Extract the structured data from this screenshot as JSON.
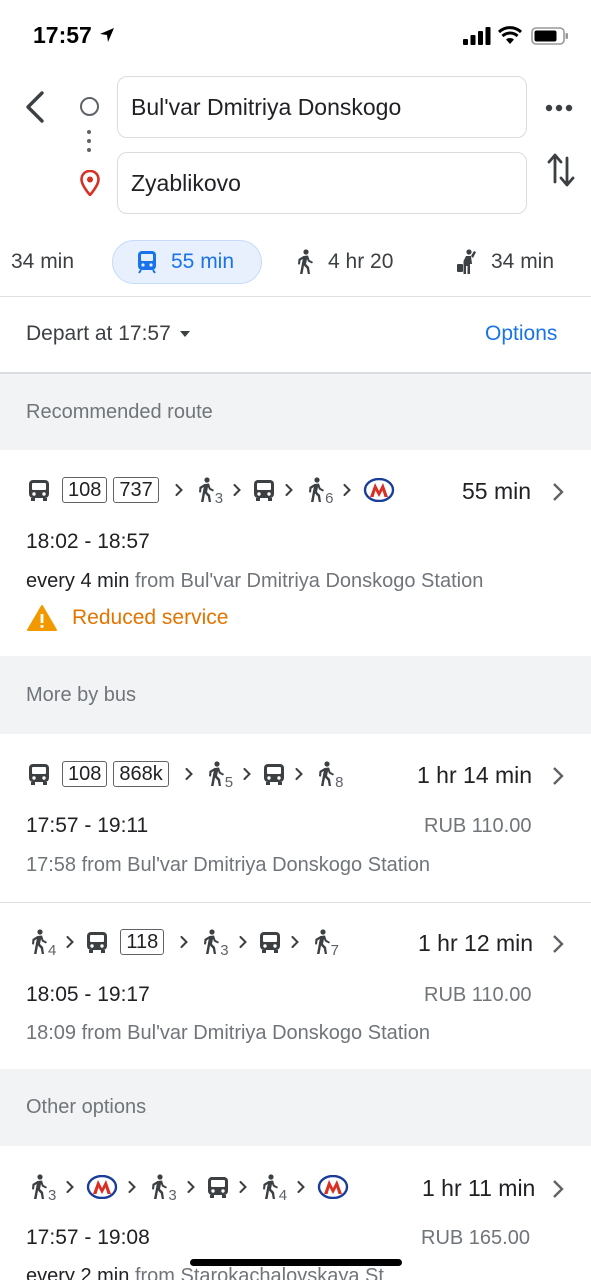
{
  "status_bar": {
    "time": "17:57"
  },
  "search": {
    "origin": "Bul'var Dmitriya Donskogo",
    "destination": "Zyablikovo"
  },
  "modes": [
    {
      "name": "drive",
      "label": "34 min"
    },
    {
      "name": "transit",
      "label": "55 min",
      "selected": true
    },
    {
      "name": "walk",
      "label": "4 hr 20"
    },
    {
      "name": "ride",
      "label": "34 min"
    }
  ],
  "depart": {
    "label": "Depart at 17:57",
    "options_label": "Options"
  },
  "sections": {
    "recommended": "Recommended route",
    "more_bus": "More by bus",
    "other": "Other options"
  },
  "routes": [
    {
      "badges": [
        "108",
        "737"
      ],
      "walk_minutes": [
        "3",
        "6"
      ],
      "duration": "55 min",
      "times": "18:02 - 18:57",
      "frequency": "every 4 min",
      "from": "from Bul'var Dmitriya Donskogo Station",
      "alert": "Reduced service"
    },
    {
      "badges": [
        "108",
        "868k"
      ],
      "walk_minutes": [
        "5",
        "8"
      ],
      "duration": "1 hr 14 min",
      "times": "17:57 - 19:11",
      "price": "RUB 110.00",
      "from": "17:58 from Bul'var Dmitriya Donskogo Station"
    },
    {
      "badges": [
        "118"
      ],
      "walk_minutes": [
        "4",
        "3",
        "7"
      ],
      "duration": "1 hr 12 min",
      "times": "18:05 - 19:17",
      "price": "RUB 110.00",
      "from": "18:09 from Bul'var Dmitriya Donskogo Station"
    },
    {
      "walk_minutes": [
        "3",
        "3",
        "4"
      ],
      "duration": "1 hr 11 min",
      "times": "17:57 - 19:08",
      "price": "RUB 165.00",
      "frequency": "every 2 min",
      "from": "from Starokachalovskaya St"
    }
  ],
  "colors": {
    "accent": "#1a73e8",
    "metro_red": "#d93025",
    "warning": "#e37400",
    "section_bg": "#f1f3f4"
  },
  "icons": [
    "bus-icon",
    "walk-icon",
    "metro-icon",
    "chevron-right-icon",
    "warning-icon",
    "swap-icon",
    "more-icon",
    "back-icon"
  ]
}
